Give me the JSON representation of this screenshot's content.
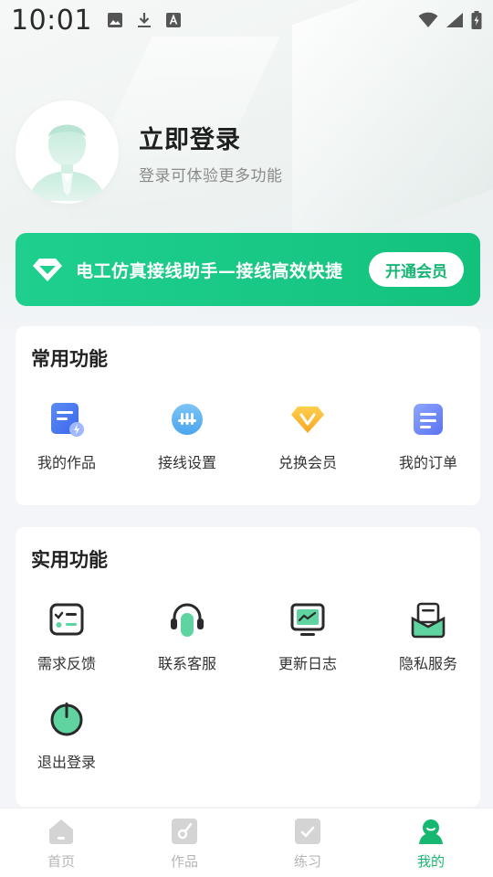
{
  "status_bar": {
    "time": "10:01",
    "icons_left": [
      "image-icon",
      "download-icon",
      "text-icon"
    ],
    "icons_right": [
      "wifi-icon",
      "signal-icon",
      "battery-icon"
    ]
  },
  "profile": {
    "title": "立即登录",
    "subtitle": "登录可体验更多功能"
  },
  "vip_banner": {
    "text": "电工仿真接线助手—接线高效快捷",
    "button": "开通会员",
    "accent": "#1fcf8e"
  },
  "common_functions": {
    "title": "常用功能",
    "items": [
      {
        "label": "我的作品",
        "icon": "works-icon"
      },
      {
        "label": "接线设置",
        "icon": "wiring-settings-icon"
      },
      {
        "label": "兑换会员",
        "icon": "redeem-vip-icon"
      },
      {
        "label": "我的订单",
        "icon": "orders-icon"
      }
    ]
  },
  "practical_functions": {
    "title": "实用功能",
    "items": [
      {
        "label": "需求反馈",
        "icon": "feedback-icon"
      },
      {
        "label": "联系客服",
        "icon": "headset-icon"
      },
      {
        "label": "更新日志",
        "icon": "monitor-icon"
      },
      {
        "label": "隐私服务",
        "icon": "privacy-icon"
      },
      {
        "label": "退出登录",
        "icon": "power-icon"
      }
    ]
  },
  "tabbar": {
    "tabs": [
      {
        "label": "首页",
        "icon": "home-icon",
        "active": false
      },
      {
        "label": "作品",
        "icon": "works-tab-icon",
        "active": false
      },
      {
        "label": "练习",
        "icon": "practice-icon",
        "active": false
      },
      {
        "label": "我的",
        "icon": "profile-icon",
        "active": true
      }
    ],
    "active_color": "#16b871"
  }
}
